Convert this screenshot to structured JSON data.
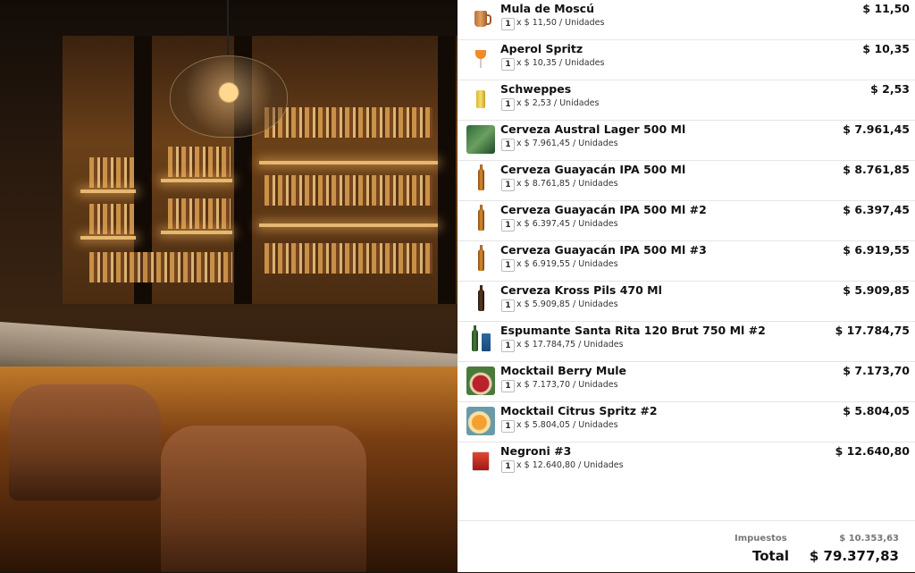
{
  "order": {
    "currency": "$",
    "items": [
      {
        "name": "Mula de Moscú",
        "qty": "1",
        "unit_line": "x $ 11,50 / Unidades",
        "price": "$ 11,50",
        "icon": "copper-mug-icon"
      },
      {
        "name": "Aperol Spritz",
        "qty": "1",
        "unit_line": "x $ 10,35 / Unidades",
        "price": "$ 10,35",
        "icon": "wine-glass-icon"
      },
      {
        "name": "Schweppes",
        "qty": "1",
        "unit_line": "x $ 2,53 / Unidades",
        "price": "$ 2,53",
        "icon": "soda-can-icon"
      },
      {
        "name": "Cerveza Austral Lager 500 Ml",
        "qty": "1",
        "unit_line": "x $ 7.961,45 / Unidades",
        "price": "$ 7.961,45",
        "icon": "beer-photo-icon"
      },
      {
        "name": "Cerveza Guayacán IPA 500 Ml",
        "qty": "1",
        "unit_line": "x $ 8.761,85 / Unidades",
        "price": "$ 8.761,85",
        "icon": "beer-bottle-icon"
      },
      {
        "name": "Cerveza Guayacán IPA 500 Ml #2",
        "qty": "1",
        "unit_line": "x $ 6.397,45 / Unidades",
        "price": "$ 6.397,45",
        "icon": "beer-bottle-icon"
      },
      {
        "name": "Cerveza Guayacán IPA 500 Ml #3",
        "qty": "1",
        "unit_line": "x $ 6.919,55 / Unidades",
        "price": "$ 6.919,55",
        "icon": "beer-bottle-icon"
      },
      {
        "name": "Cerveza Kross Pils 470 Ml",
        "qty": "1",
        "unit_line": "x $ 5.909,85 / Unidades",
        "price": "$ 5.909,85",
        "icon": "dark-bottle-icon"
      },
      {
        "name": "Espumante Santa Rita 120 Brut 750 Ml #2",
        "qty": "1",
        "unit_line": "x $ 17.784,75 / Unidades",
        "price": "$ 17.784,75",
        "icon": "sparkling-wine-icon"
      },
      {
        "name": "Mocktail Berry Mule",
        "qty": "1",
        "unit_line": "x $ 7.173,70 / Unidades",
        "price": "$ 7.173,70",
        "icon": "berry-drink-photo-icon"
      },
      {
        "name": "Mocktail Citrus Spritz #2",
        "qty": "1",
        "unit_line": "x $ 5.804,05 / Unidades",
        "price": "$ 5.804,05",
        "icon": "citrus-drink-photo-icon"
      },
      {
        "name": "Negroni #3",
        "qty": "1",
        "unit_line": "x $ 12.640,80 / Unidades",
        "price": "$ 12.640,80",
        "icon": "negroni-glass-icon"
      }
    ],
    "footer": {
      "tax_label": "Impuestos",
      "tax_value": "$ 10.353,63",
      "total_label": "Total",
      "total_value": "$ 79.377,83"
    }
  },
  "colors": {
    "panel_bg": "#ffffff",
    "text": "#111111",
    "muted": "#777777",
    "divider": "#e5e5e5"
  }
}
